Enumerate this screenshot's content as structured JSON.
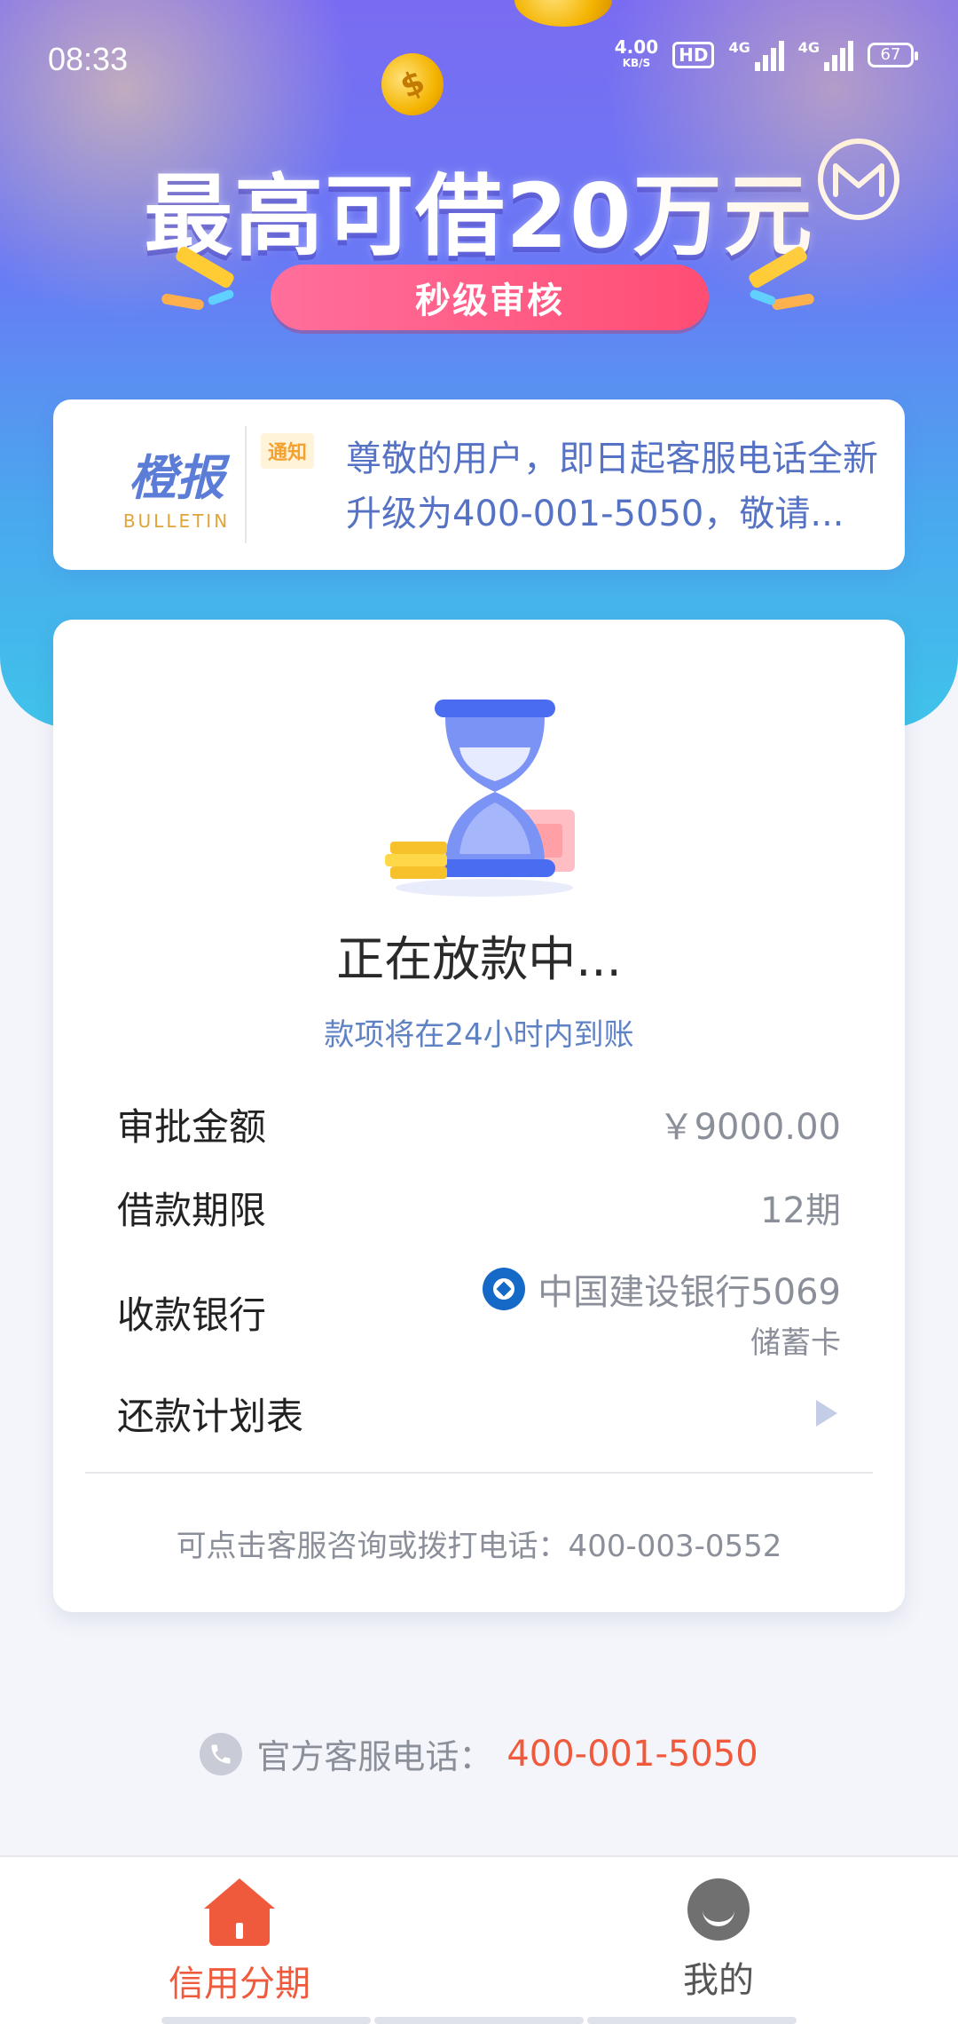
{
  "status_bar": {
    "time": "08:33",
    "net_speed_value": "4.00",
    "net_speed_unit": "KB/S",
    "hd": "HD",
    "sim1": "4G",
    "sim2": "4G",
    "battery": "67"
  },
  "banner": {
    "headline": "最高可借20万元",
    "pill": "秒级审核"
  },
  "bulletin": {
    "logo_cn": "橙报",
    "logo_en": "BULLETIN",
    "tag": "通知",
    "text": "尊敬的用户，即日起客服电话全新升级为400-001-5050，敬请..."
  },
  "loan": {
    "status_title": "正在放款中...",
    "status_sub": "款项将在24小时内到账",
    "amount_label": "审批金额",
    "amount_value": "￥9000.00",
    "term_label": "借款期限",
    "term_value": "12期",
    "bank_label": "收款银行",
    "bank_name": "中国建设银行5069",
    "bank_type": "储蓄卡",
    "plan_label": "还款计划表",
    "footer": "可点击客服咨询或拨打电话：400-003-0552"
  },
  "hotline": {
    "label": "官方客服电话：",
    "number": "400-001-5050"
  },
  "nav": {
    "home_label": "信用分期",
    "mine_label": "我的"
  },
  "colors": {
    "accent": "#f05a3c",
    "link_blue": "#5f82c4",
    "banner_top": "#7a6cf2",
    "banner_bottom": "#3fc3ea"
  }
}
